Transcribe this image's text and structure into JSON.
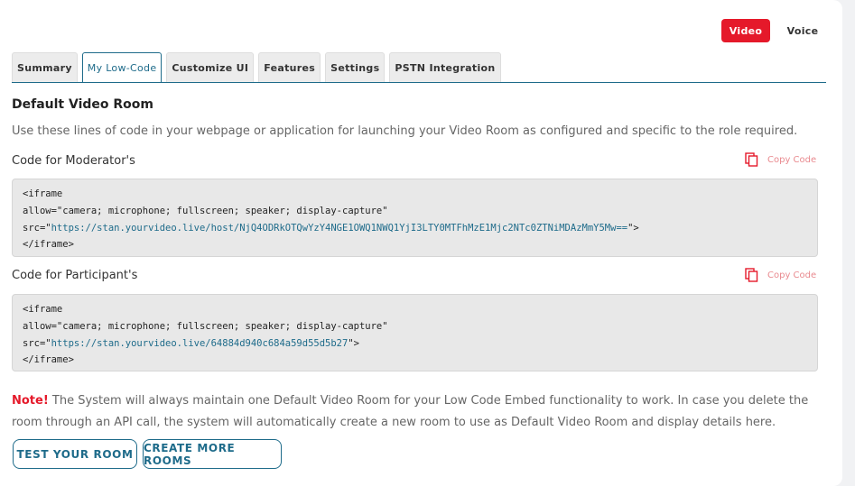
{
  "toggles": {
    "video": "Video",
    "voice": "Voice"
  },
  "tabs": [
    "Summary",
    "My Low-Code",
    "Customize UI",
    "Features",
    "Settings",
    "PSTN Integration"
  ],
  "title": "Default Video Room",
  "description": "Use these lines of code in your webpage or application for launching your Video Room as configured and specific to the role required.",
  "moderator": {
    "label": "Code for Moderator's",
    "copy_label": "Copy Code",
    "code_open": "<iframe",
    "code_allow": "allow=\"camera; microphone; fullscreen; speaker; display-capture\"",
    "code_src_prefix": "src=\"",
    "code_url": "https://stan.yourvideo.live/host/NjQ4ODRkOTQwYzY4NGE1OWQ1NWQ1YjI3LTY0MTFhMzE1Mjc2NTc0ZTNiMDAzMmY5Mw==",
    "code_src_suffix": "\">",
    "code_close": "</iframe>"
  },
  "participant": {
    "label": "Code for Participant's",
    "copy_label": "Copy Code",
    "code_open": "<iframe",
    "code_allow": "allow=\"camera; microphone; fullscreen; speaker; display-capture\"",
    "code_src_prefix": "src=\"",
    "code_url": "https://stan.yourvideo.live/64884d940c684a59d55d5b27",
    "code_src_suffix": "\">",
    "code_close": "</iframe>"
  },
  "note": {
    "warn": "Note!",
    "text": " The System will always maintain one Default Video Room for your Low Code Embed functionality to work. In case you delete the room through an API call, the system will automatically create a new room to use as Default Video Room and display details here."
  },
  "buttons": {
    "test": "TEST YOUR ROOM",
    "create": "CREATE MORE ROOMS"
  },
  "colors": {
    "accent": "#1e6b8a",
    "brand_red": "#e5192a"
  }
}
